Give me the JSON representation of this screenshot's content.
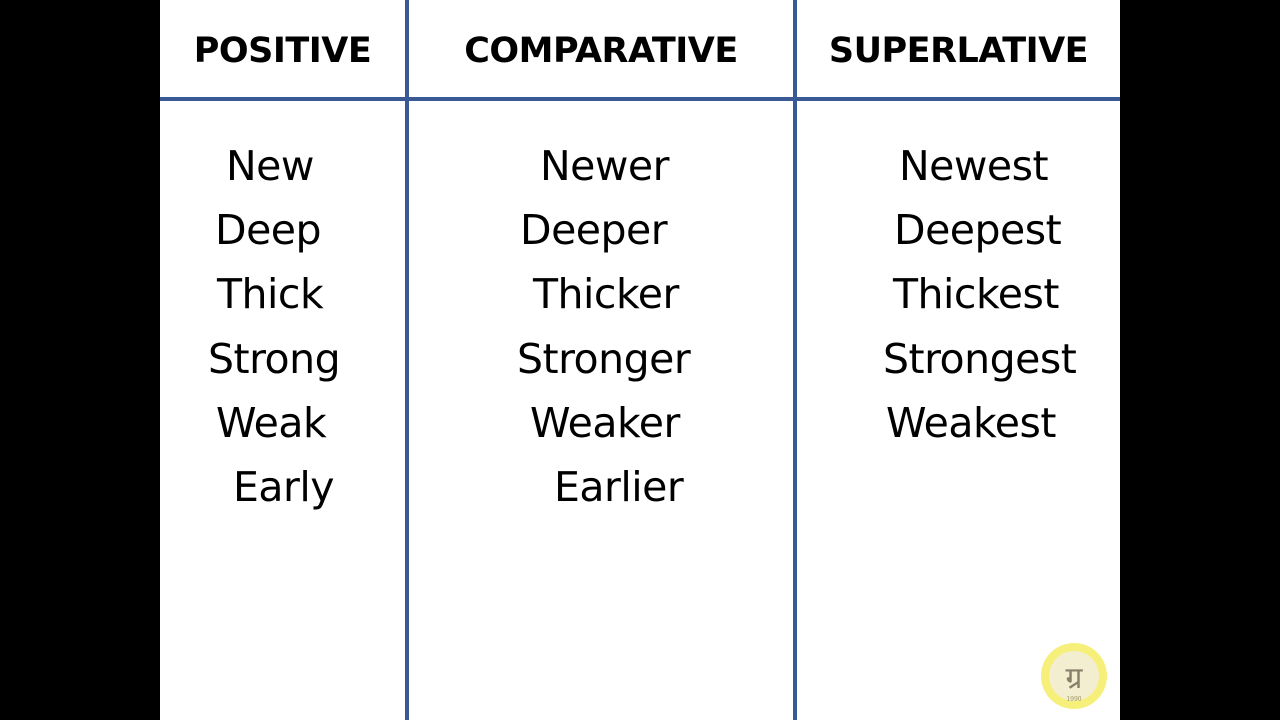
{
  "headers": [
    "POSITIVE",
    "COMPARATIVE",
    "SUPERLATIVE"
  ],
  "columns": {
    "positive": [
      "New",
      "Deep",
      "Thick",
      "Strong",
      "Weak",
      "Early"
    ],
    "comparative": [
      "Newer",
      "Deeper",
      "Thicker",
      "Stronger",
      "Weaker",
      "Earlier"
    ],
    "superlative": [
      "Newest",
      "Deepest",
      "Thickest",
      "Strongest",
      "Weakest"
    ]
  },
  "logo": {
    "glyph": "ग्र",
    "year": "1990"
  },
  "colors": {
    "rule_line": "#3a5a96",
    "logo_ring": "#f6ef7a"
  }
}
